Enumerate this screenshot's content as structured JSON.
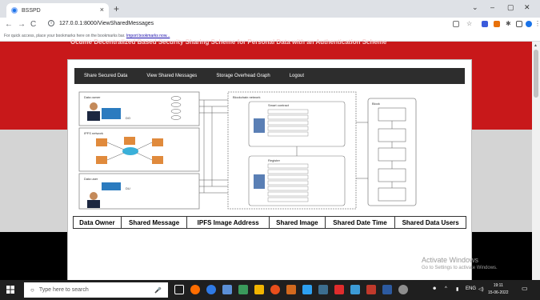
{
  "browser": {
    "tab_title": "BSSPD",
    "close_glyph": "×",
    "new_tab_glyph": "+",
    "url": "127.0.0.1:8000/ViewSharedMessages",
    "back_glyph": "←",
    "forward_glyph": "→",
    "reload_glyph": "C",
    "bookmarks_text": "For quick access, place your bookmarks here on the bookmarks bar.",
    "bookmarks_link": "Import bookmarks now...",
    "min_glyph": "–",
    "max_glyph": "▢",
    "close_window_glyph": "✕",
    "chevron_glyph": "⌄"
  },
  "page": {
    "header_title": "Ocume Decentralized Based Security Sharing Scheme for Personal Data with an Authentication Scheme",
    "menu": [
      "Share Secured Data",
      "View Shared Messages",
      "Storage Overhead Graph",
      "Logout"
    ],
    "table_headers": [
      "Data Owner",
      "Shared Message",
      "IPFS Image Address",
      "Shared Image",
      "Shared Date Time",
      "Shared Data Users"
    ]
  },
  "diagram_labels": {
    "data_owner": "Data owner",
    "ipfs_network": "IPFS network",
    "data_user": "Data user",
    "blockchain": "Blockchain network",
    "sc_contract": "Smart contract",
    "login_register": "Register",
    "block": "Block",
    "dc_label": "DO",
    "du_label": "DU"
  },
  "overlay": {
    "activate_title": "Activate Windows",
    "activate_sub": "Go to Settings to activate Windows."
  },
  "taskbar": {
    "search_placeholder": "Type here to search",
    "time": "19:11",
    "date": "15-06-2022",
    "lang": "ENG"
  },
  "colors": {
    "header_red": "#c8181a",
    "menu_bg": "#2d2d2d"
  }
}
